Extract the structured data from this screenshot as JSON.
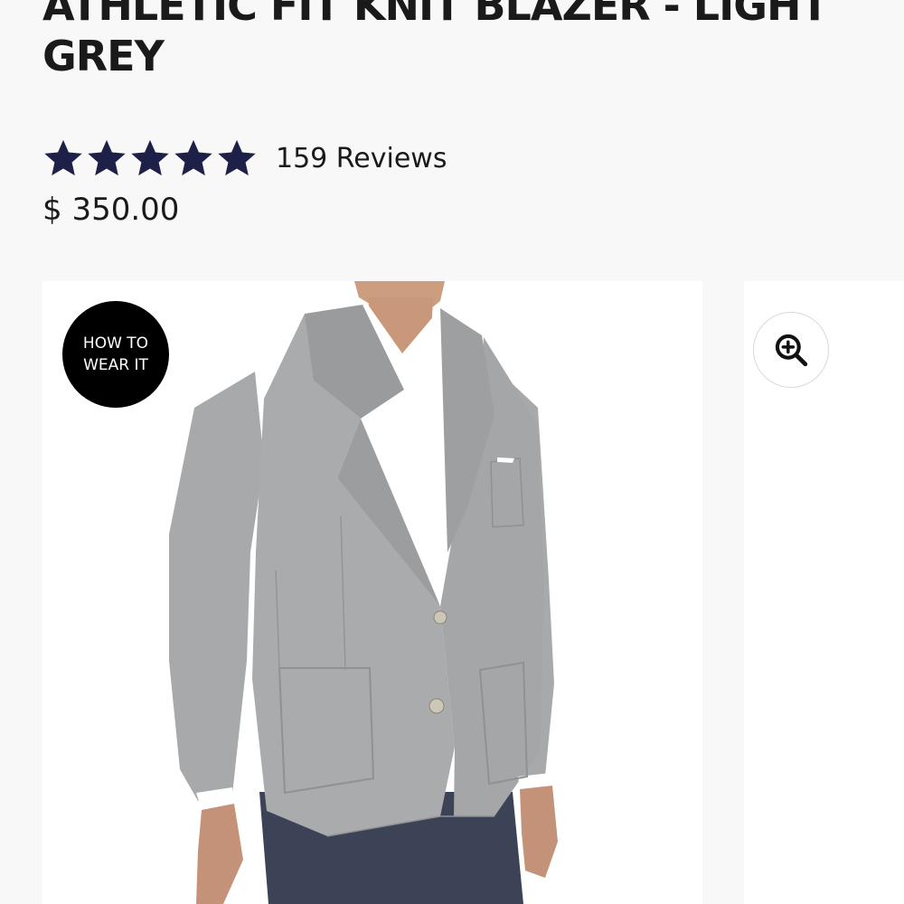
{
  "product": {
    "title": "ATHLETIC FIT KNIT BLAZER - LIGHT GREY",
    "rating": 5,
    "rating_max": 5,
    "reviews": "159 Reviews",
    "price": "$ 350.00"
  },
  "gallery": {
    "badge_line1": "HOW TO",
    "badge_line2": "WEAR IT",
    "image_alt": "Model wearing the light grey athletic fit knit blazer over a white shirt and navy pants",
    "zoom_icon": "zoom-in-icon"
  },
  "colors": {
    "star": "#1e2048",
    "blazer": "#a7a9aa",
    "badge": "#000000",
    "background": "#f8f8f8"
  }
}
